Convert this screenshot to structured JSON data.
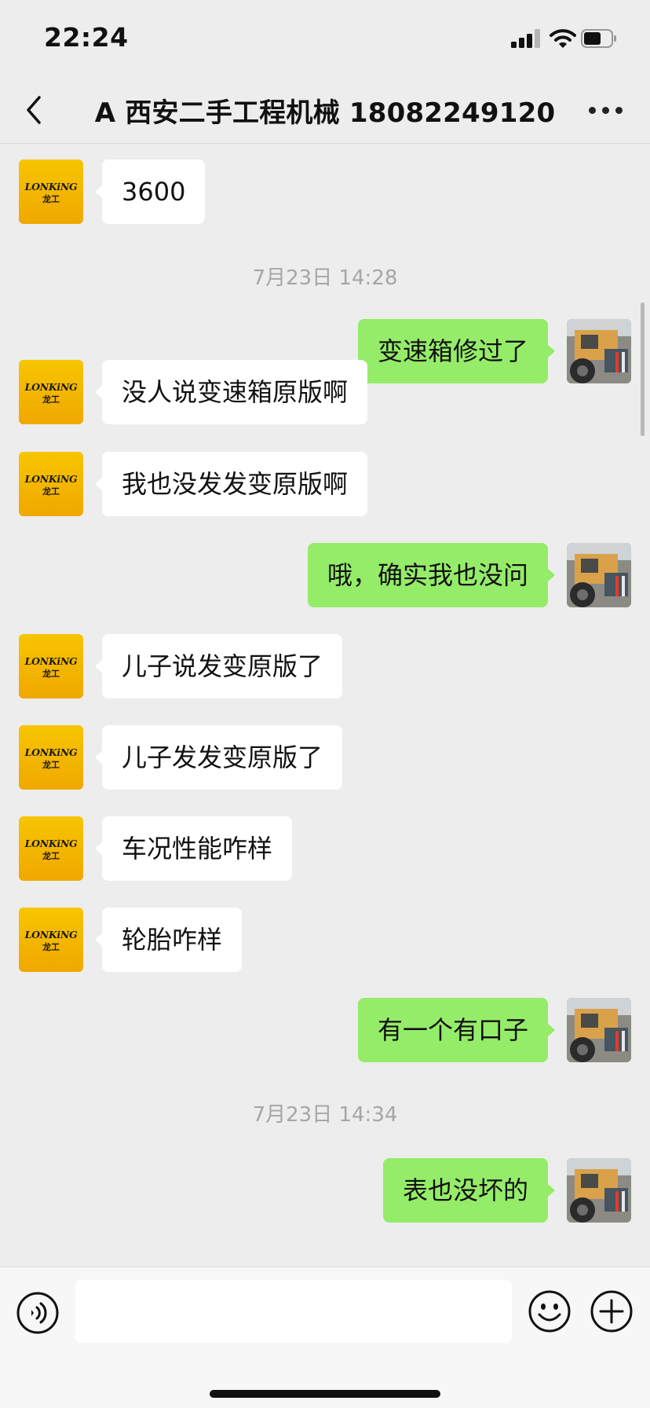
{
  "status_bar": {
    "time": "22:24"
  },
  "header": {
    "title": "A 西安二手工程机械 18082249120"
  },
  "avatars": {
    "contact_logo_text": "LONKiNG",
    "contact_logo_cn": "龙工"
  },
  "messages": [
    {
      "side": "left",
      "text": "3600"
    },
    {
      "type": "timestamp",
      "text": "7月23日 14:28"
    },
    {
      "side": "right",
      "text": "变速箱修过了"
    },
    {
      "side": "left",
      "text": "没人说变速箱原版啊"
    },
    {
      "side": "left",
      "text": "我也没发发变原版啊"
    },
    {
      "side": "right",
      "text": "哦，确实我也没问"
    },
    {
      "side": "left",
      "text": "儿子说发变原版了"
    },
    {
      "side": "left",
      "text": "儿子发发变原版了"
    },
    {
      "side": "left",
      "text": "车况性能咋样"
    },
    {
      "side": "left",
      "text": "轮胎咋样"
    },
    {
      "side": "right",
      "text": "有一个有口子"
    },
    {
      "type": "timestamp",
      "text": "7月23日 14:34"
    },
    {
      "side": "right",
      "text": "表也没坏的"
    }
  ],
  "input": {
    "value": ""
  },
  "colors": {
    "sent_bubble": "#95ec69",
    "received_bubble": "#ffffff",
    "background": "#ededed",
    "logo": "#f5b800"
  },
  "icons": [
    "back-icon",
    "more-icon",
    "voice-icon",
    "emoji-icon",
    "plus-icon",
    "signal-icon",
    "wifi-icon",
    "battery-icon"
  ]
}
